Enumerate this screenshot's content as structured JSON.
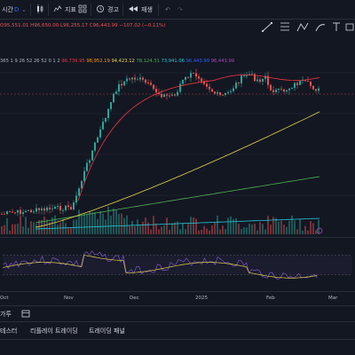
{
  "toolbar": {
    "interval_label": "시간",
    "interval_value": "D",
    "indicators_label": "지표",
    "alert_label": "경고",
    "replay_label": "재생"
  },
  "ohlc": {
    "open": "O95,551.01",
    "high": "H96,650.00",
    "low": "L96,255.17",
    "close": "C96,443.99",
    "change": "−107.02 (−0.11%)"
  },
  "ma_row": {
    "lengths": "365 1 9 26 52 26 52 0 1 2",
    "v1": "96,739.95",
    "v2": "98,952.19",
    "v3": "94,423.12",
    "v4": "78,124.31",
    "v5": "73,941.06",
    "v6": "96,443.99",
    "v7": "96,443.99"
  },
  "time_axis": {
    "labels": [
      "Oct",
      "Nov",
      "Dec",
      "2025",
      "Feb",
      "Mar"
    ]
  },
  "bottom": {
    "goto_label": "가투"
  },
  "tabs": [
    "테스터",
    "리플레이 트레이딩",
    "트레이딩 패널"
  ],
  "colors": {
    "background": "#131722",
    "up": "#26a69a",
    "down": "#ef5350",
    "ma_red": "#f23645",
    "ma_yellow": "#e8d44d",
    "ma_green": "#4caf50",
    "ma_cyan": "#26c6da",
    "rsi_line": "#7e57c2",
    "rsi_signal": "#e8d44d"
  }
}
